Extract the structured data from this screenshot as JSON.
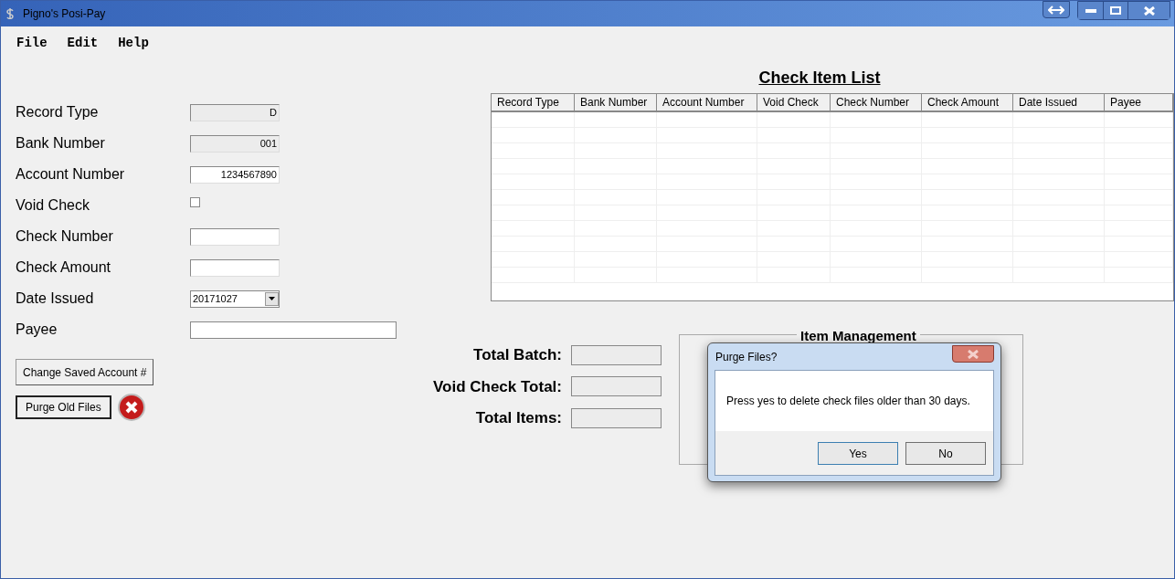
{
  "window": {
    "title": "Pigno's Posi-Pay"
  },
  "menu": [
    "File",
    "Edit",
    "Help"
  ],
  "form": [
    {
      "kind": "text",
      "label": "Record Type",
      "value": "D",
      "disabled": true
    },
    {
      "kind": "text",
      "label": "Bank Number",
      "value": "001",
      "disabled": true
    },
    {
      "kind": "text",
      "label": "Account Number",
      "value": "1234567890",
      "disabled": false
    },
    {
      "kind": "checkbox",
      "label": "Void Check",
      "checked": false
    },
    {
      "kind": "text",
      "label": "Check Number",
      "disabled": false
    },
    {
      "kind": "text",
      "label": "Check Amount",
      "disabled": false
    },
    {
      "kind": "date",
      "label": "Date Issued",
      "value": "20171027"
    },
    {
      "kind": "wide",
      "label": "Payee"
    }
  ],
  "buttons": [
    "Change Saved Account #",
    "Purge Old Files"
  ],
  "table": {
    "title": "Check Item List",
    "columns": [
      "Record Type",
      "Bank Number",
      "Account Number",
      "Void Check",
      "Check Number",
      "Check Amount",
      "Date Issued",
      "Payee"
    ]
  },
  "totals": [
    "Total Batch:",
    "Void Check Total:",
    "Total Items:"
  ],
  "group": {
    "title": "Item Management"
  },
  "dialog": {
    "title": "Purge Files?",
    "message": "Press yes to delete check files older than 30 days.",
    "buttons": [
      "Yes",
      "No"
    ]
  }
}
